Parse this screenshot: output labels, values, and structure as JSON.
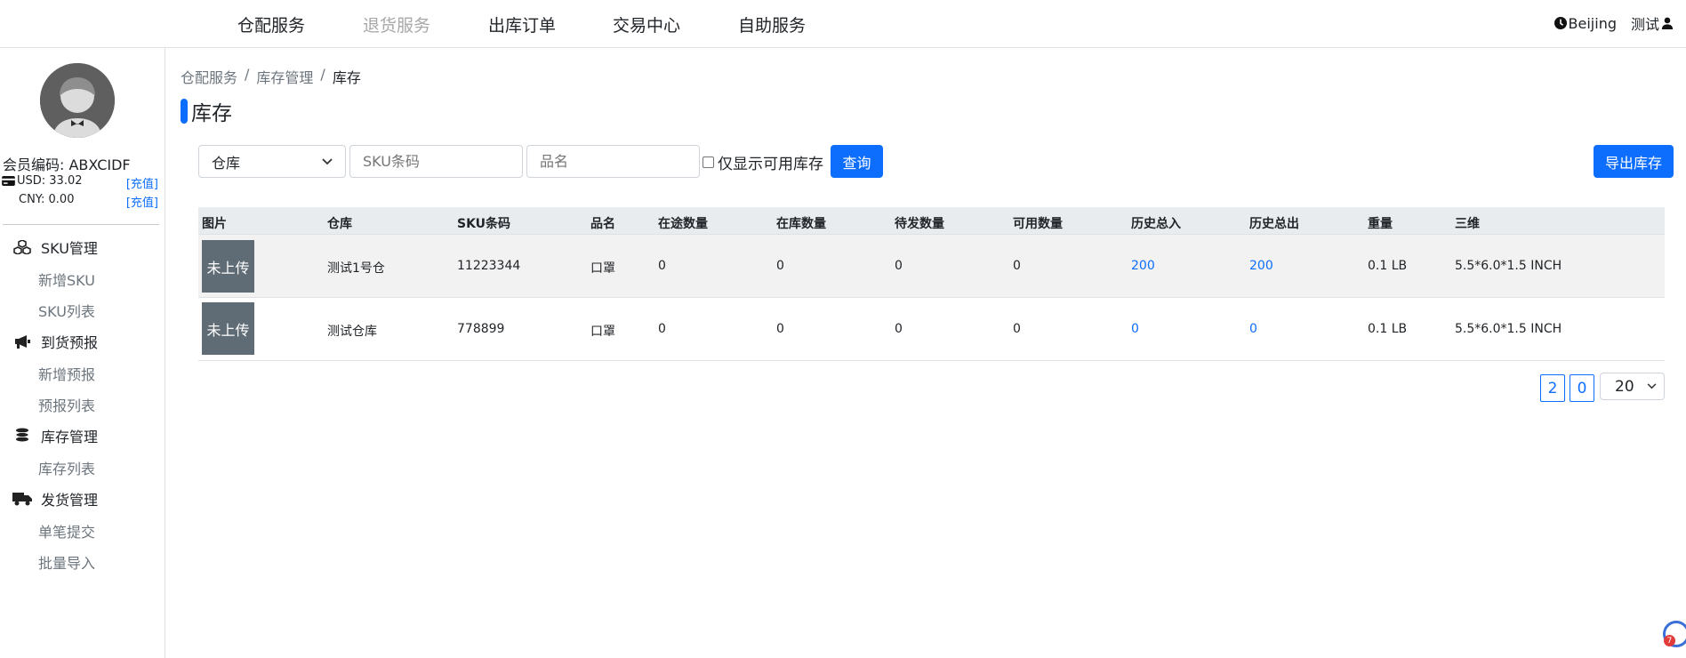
{
  "topnav": {
    "items": [
      {
        "label": "仓配服务",
        "disabled": false
      },
      {
        "label": "退货服务",
        "disabled": true
      },
      {
        "label": "出库订单",
        "disabled": false
      },
      {
        "label": "交易中心",
        "disabled": false
      },
      {
        "label": "自助服务",
        "disabled": false
      }
    ],
    "timezone": "Beijing",
    "user": "测试"
  },
  "sidebar": {
    "member_code": "会员编码: ABXCIDF",
    "usd": "USD: 33.02",
    "cny": "CNY: 0.00",
    "recharge": "[充值]",
    "groups": [
      {
        "title": "SKU管理",
        "icon": "cubes-icon",
        "items": [
          "新增SKU",
          "SKU列表"
        ]
      },
      {
        "title": "到货预报",
        "icon": "bullhorn-icon",
        "items": [
          "新增预报",
          "预报列表"
        ]
      },
      {
        "title": "库存管理",
        "icon": "coins-icon",
        "items": [
          "库存列表"
        ]
      },
      {
        "title": "发货管理",
        "icon": "truck-icon",
        "items": [
          "单笔提交",
          "批量导入"
        ]
      }
    ]
  },
  "breadcrumb": [
    "仓配服务",
    "库存管理",
    "库存"
  ],
  "page_title": "库存",
  "filters": {
    "warehouse_selected": "仓库",
    "sku_placeholder": "SKU条码",
    "name_placeholder": "品名",
    "only_available_label": "仅显示可用库存",
    "query_button": "查询",
    "export_button": "导出库存"
  },
  "table": {
    "headers": [
      "图片",
      "仓库",
      "SKU条码",
      "品名",
      "在途数量",
      "在库数量",
      "待发数量",
      "可用数量",
      "历史总入",
      "历史总出",
      "重量",
      "三维"
    ],
    "rows": [
      {
        "image": "未上传",
        "warehouse": "测试1号仓",
        "sku": "11223344",
        "name": "口罩",
        "in_transit": "0",
        "in_stock": "0",
        "pending": "0",
        "available": "0",
        "total_in": "200",
        "total_out": "200",
        "weight": "0.1 LB",
        "dims": "5.5*6.0*1.5 INCH"
      },
      {
        "image": "未上传",
        "warehouse": "测试仓库",
        "sku": "778899",
        "name": "口罩",
        "in_transit": "0",
        "in_stock": "0",
        "pending": "0",
        "available": "0",
        "total_in": "0",
        "total_out": "0",
        "weight": "0.1 LB",
        "dims": "5.5*6.0*1.5 INCH"
      }
    ]
  },
  "pagination": {
    "pages": [
      "2",
      "0"
    ],
    "page_size": "20"
  },
  "colors": {
    "accent": "#0d6efd",
    "thumb": "#5f6b75",
    "header_bg": "#e9ecef"
  },
  "float_badge": "7"
}
